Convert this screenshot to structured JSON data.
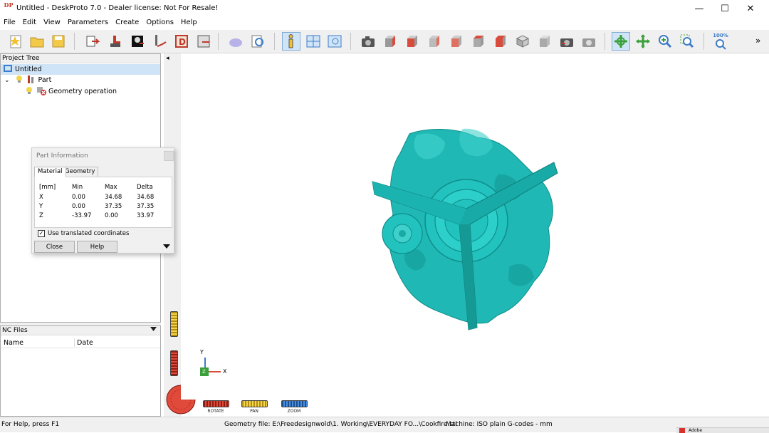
{
  "window": {
    "title": "Untitled - DeskProto 7.0 - Dealer license: Not For Resale!",
    "logo_text": "DP",
    "minimize": "—",
    "maximize": "☐",
    "close": "✕"
  },
  "menu": [
    "File",
    "Edit",
    "View",
    "Parameters",
    "Create",
    "Options",
    "Help"
  ],
  "toolbar": {
    "zoom_label": "100%",
    "overflow": "»"
  },
  "project_tree": {
    "header": "Project Tree",
    "root": "Untitled",
    "part": "Part",
    "operation": "Geometry operation",
    "collapse_glyph": "◂"
  },
  "nc_files": {
    "header": "NC Files",
    "col_name": "Name",
    "col_date": "Date"
  },
  "part_info": {
    "title": "Part Information",
    "tabs": [
      "Material",
      "Geometry"
    ],
    "headers": [
      "[mm]",
      "Min",
      "Max",
      "Delta"
    ],
    "rows": [
      [
        "X",
        "0.00",
        "34.68",
        "34.68"
      ],
      [
        "Y",
        "0.00",
        "37.35",
        "37.35"
      ],
      [
        "Z",
        "-33.97",
        "0.00",
        "33.97"
      ]
    ],
    "checkbox_label": "Use translated coordinates",
    "checkbox_checked": true,
    "close_label": "Close",
    "help_label": "Help"
  },
  "viewport": {
    "axis_y": "Y",
    "axis_x": "X",
    "axis_z": "Z",
    "rotate_label": "ROTATE",
    "pan_label": "PAN",
    "zoom_label": "ZOOM",
    "model_color": "#1fb8b4"
  },
  "status": {
    "help": "For Help, press F1",
    "geometry_file": "Geometry file: E:\\Freedesignwold\\1. Working\\EVERYDAY FO...\\Cookfire.stl",
    "machine": "Machine: ISO plain G-codes - mm",
    "taskbar_hint": "Adobe"
  }
}
